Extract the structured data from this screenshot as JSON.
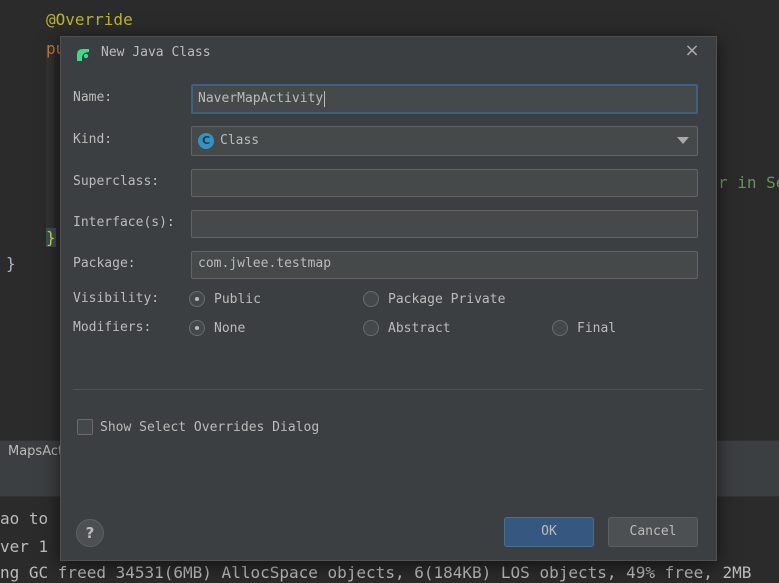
{
  "editor": {
    "annotation": "@Override",
    "pub_fragment": "pu",
    "open_brace": "}",
    "close_brace": "}",
    "right_fragment": "r in Se"
  },
  "tool_tabs": {
    "label": "MapsAct"
  },
  "console": {
    "lines": [
      "ao to",
      "ver 1",
      "ng GC freed 34531(6MB) AllocSpace objects, 6(184KB) LOS objects, 49% free, 2MB"
    ]
  },
  "dialog": {
    "title": "New Java Class",
    "close_glyph": "×",
    "name": {
      "label": "Name:",
      "value": "NaverMapActivity"
    },
    "kind": {
      "label": "Kind:",
      "value": "Class",
      "icon_letter": "C"
    },
    "superclass": {
      "label": "Superclass:",
      "value": ""
    },
    "interfaces": {
      "label": "Interface(s):",
      "value": ""
    },
    "package": {
      "label": "Package:",
      "value": "com.jwlee.testmap"
    },
    "visibility": {
      "label": "Visibility:",
      "options": [
        "Public",
        "Package Private"
      ],
      "selected": "Public"
    },
    "modifiers": {
      "label": "Modifiers:",
      "options": [
        "None",
        "Abstract",
        "Final"
      ],
      "selected": "None"
    },
    "show_overrides": {
      "label": "Show Select Overrides Dialog",
      "checked": false
    },
    "help_glyph": "?",
    "ok_label": "OK",
    "cancel_label": "Cancel"
  },
  "colors": {
    "dialog_bg": "#3c3f41",
    "editor_bg": "#2b2b2b",
    "focus_border": "#3d6185",
    "ok_button": "#365880",
    "class_icon": "#3592c4",
    "title_icon": "#3ddc84"
  }
}
